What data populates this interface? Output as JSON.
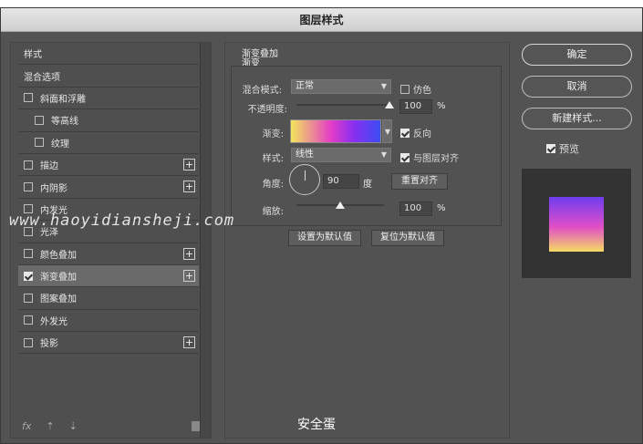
{
  "window": {
    "title": "图层样式"
  },
  "left_list": {
    "items": [
      {
        "label": "样式",
        "checkbox": false,
        "checked": false,
        "plus": false,
        "indent": false,
        "active": false
      },
      {
        "label": "混合选项",
        "checkbox": false,
        "checked": false,
        "plus": false,
        "indent": false,
        "active": false
      },
      {
        "label": "斜面和浮雕",
        "checkbox": true,
        "checked": false,
        "plus": false,
        "indent": false,
        "active": false
      },
      {
        "label": "等高线",
        "checkbox": true,
        "checked": false,
        "plus": false,
        "indent": true,
        "active": false
      },
      {
        "label": "纹理",
        "checkbox": true,
        "checked": false,
        "plus": false,
        "indent": true,
        "active": false
      },
      {
        "label": "描边",
        "checkbox": true,
        "checked": false,
        "plus": true,
        "indent": false,
        "active": false
      },
      {
        "label": "内阴影",
        "checkbox": true,
        "checked": false,
        "plus": true,
        "indent": false,
        "active": false
      },
      {
        "label": "内发光",
        "checkbox": true,
        "checked": false,
        "plus": false,
        "indent": false,
        "active": false
      },
      {
        "label": "光泽",
        "checkbox": true,
        "checked": false,
        "plus": false,
        "indent": false,
        "active": false
      },
      {
        "label": "颜色叠加",
        "checkbox": true,
        "checked": false,
        "plus": true,
        "indent": false,
        "active": false
      },
      {
        "label": "渐变叠加",
        "checkbox": true,
        "checked": true,
        "plus": true,
        "indent": false,
        "active": true
      },
      {
        "label": "图案叠加",
        "checkbox": true,
        "checked": false,
        "plus": false,
        "indent": false,
        "active": false
      },
      {
        "label": "外发光",
        "checkbox": true,
        "checked": false,
        "plus": false,
        "indent": false,
        "active": false
      },
      {
        "label": "投影",
        "checkbox": true,
        "checked": false,
        "plus": true,
        "indent": false,
        "active": false
      }
    ],
    "footer": {
      "fx": "fx",
      "up": "⇡",
      "down": "⇣",
      "trash_icon": "trash-icon"
    }
  },
  "gradient_overlay": {
    "section_title": "渐变叠加",
    "group_title": "渐变",
    "blend_mode_label": "混合模式:",
    "blend_mode_value": "正常",
    "dither_label": "仿色",
    "opacity_label": "不透明度:",
    "opacity_value": "100",
    "opacity_unit": "%",
    "opacity_level": 1.0,
    "gradient_label": "渐变:",
    "reverse_label": "反向",
    "style_label": "样式:",
    "style_value": "线性",
    "align_label": "与图层对齐",
    "angle_label": "角度:",
    "angle_value": "90",
    "angle_unit": "度",
    "reset_align_button": "重置对齐",
    "scale_label": "缩放:",
    "scale_value": "100",
    "scale_unit": "%",
    "scale_level": 0.5,
    "make_default_button": "设置为默认值",
    "reset_default_button": "复位为默认值"
  },
  "right_panel": {
    "ok_button": "确定",
    "cancel_button": "取消",
    "new_style_button": "新建样式...",
    "preview_label": "预览"
  },
  "overlay_text": {
    "watermark": "www.haoyidiansheji.com",
    "caption": "安全蛋"
  },
  "colors": {
    "gradient_start": "#f2e65a",
    "gradient_mid": "#e33cc8",
    "gradient_end": "#3b4df2"
  }
}
